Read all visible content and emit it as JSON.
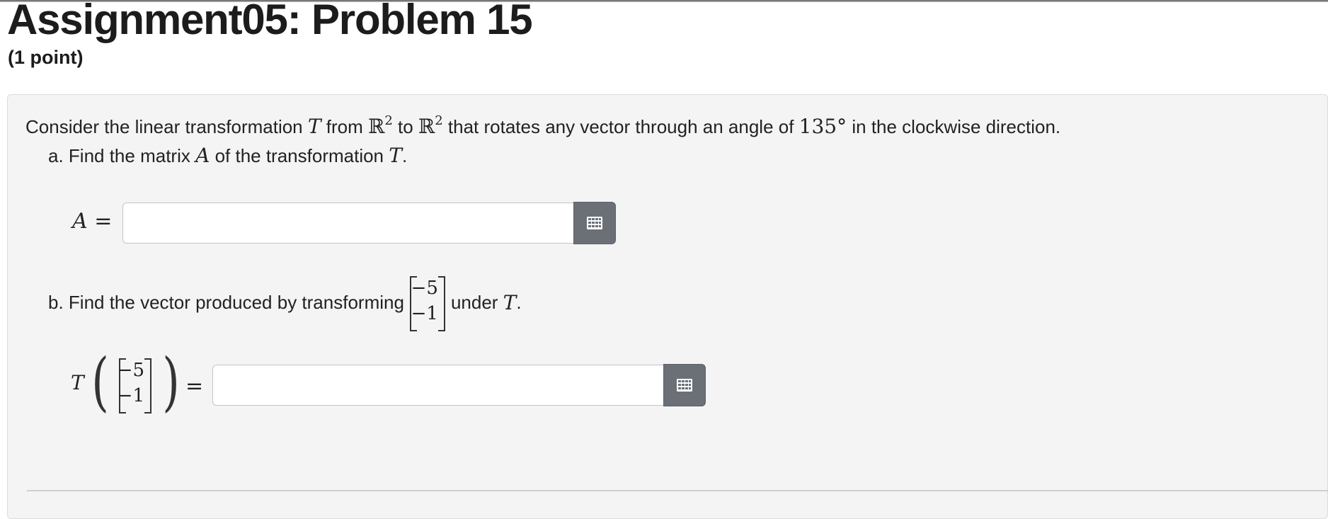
{
  "header": {
    "title": "Assignment05: Problem 15",
    "points": "(1 point)"
  },
  "problem": {
    "intro": {
      "t1": "Consider the linear transformation",
      "T": "T",
      "from": "from",
      "R": "ℝ",
      "exp": "2",
      "to": "to",
      "rest": "that rotates any vector through an angle of",
      "angle": "135°",
      "end": "in the clockwise direction."
    },
    "part_a": {
      "text": "a. Find the matrix",
      "A": "A",
      "text2": "of the transformation",
      "T": "T",
      "period": ".",
      "lhs": "A =",
      "answer_value": ""
    },
    "part_b": {
      "text": "b. Find the vector produced by transforming",
      "vec_top": "−5",
      "vec_bottom": "−1",
      "under": "under",
      "T": "T",
      "period": ".",
      "lhs_T": "T",
      "equals": "=",
      "answer_value": ""
    }
  },
  "icons": {
    "matrix_button": "grid-icon",
    "matrix_button_color": "#6b7077"
  }
}
